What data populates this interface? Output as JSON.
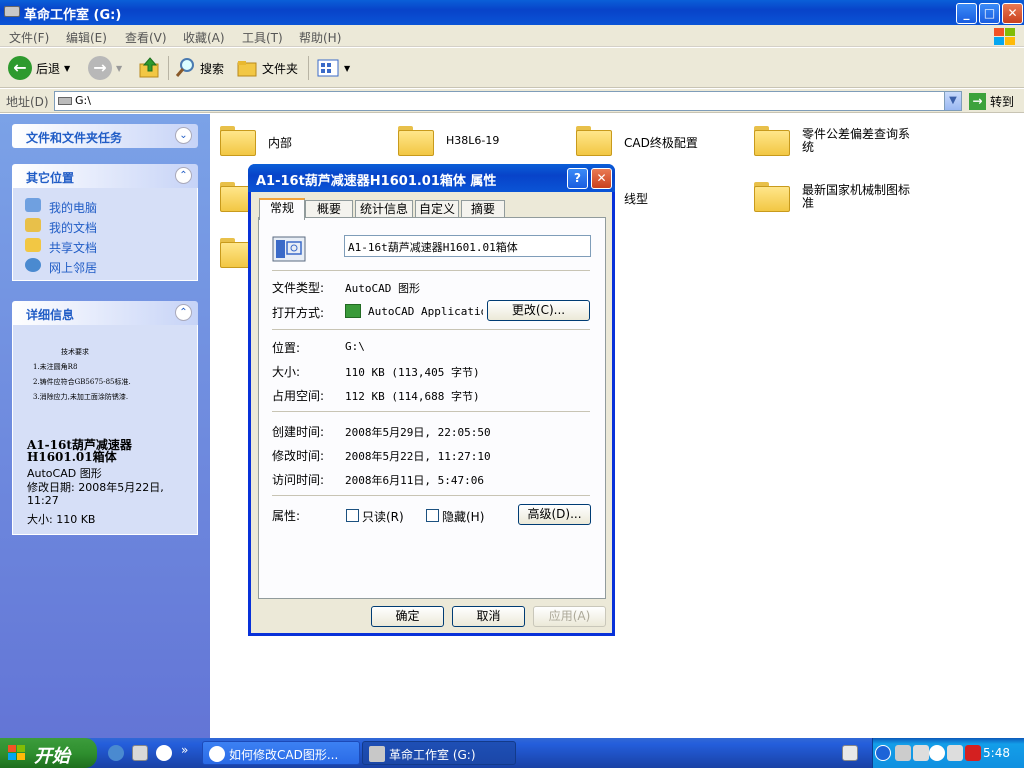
{
  "window": {
    "title": "革命工作室 (G:)",
    "controls": {
      "minimize": "_",
      "maximize": "□",
      "close": "✕"
    }
  },
  "menu": [
    "文件(F)",
    "编辑(E)",
    "查看(V)",
    "收藏(A)",
    "工具(T)",
    "帮助(H)"
  ],
  "toolbar": {
    "back_label": "后退",
    "search_label": "搜索",
    "folders_label": "文件夹"
  },
  "address": {
    "label": "地址(D)",
    "value": "G:\\",
    "go_label": "转到"
  },
  "left_pane": {
    "tasks_title": "文件和文件夹任务",
    "other_places_title": "其它位置",
    "other_places": [
      {
        "label": "我的电脑",
        "icon": "computer-icon"
      },
      {
        "label": "我的文档",
        "icon": "documents-icon"
      },
      {
        "label": "共享文档",
        "icon": "folder-icon"
      },
      {
        "label": "网上邻居",
        "icon": "network-icon"
      }
    ],
    "details_title": "详细信息",
    "thumb_lines": [
      "技术要求",
      "1.未注圆角R8",
      "2.铸件应符合GB5675-85标准.",
      "3.消除应力,未加工面涂防锈漆."
    ],
    "file_name": "A1-16t葫芦减速器H1601.01箱体",
    "file_type": "AutoCAD 图形",
    "modified": "修改日期: 2008年5月22日, 11:27",
    "size": "大小: 110 KB"
  },
  "files": [
    {
      "name": "内部"
    },
    {
      "name": "H38L6-19"
    },
    {
      "name": "CAD终极配置"
    },
    {
      "name": "零件公差偏差查询系统"
    },
    {
      "name": "线型"
    },
    {
      "name": "最新国家机械制图标准"
    }
  ],
  "dialog": {
    "title": "A1-16t葫芦减速器H1601.01箱体 属性",
    "help": "?",
    "close": "✕",
    "tabs": [
      "常规",
      "概要",
      "统计信息",
      "自定义",
      "摘要"
    ],
    "filename": "A1-16t葫芦减速器H1601.01箱体",
    "file_type_label": "文件类型:",
    "file_type": "AutoCAD 图形",
    "open_with_label": "打开方式:",
    "open_with": "AutoCAD Application",
    "change_btn": "更改(C)...",
    "location_label": "位置:",
    "location": "G:\\",
    "size_label": "大小:",
    "size": "110 KB (113,405 字节)",
    "size_on_disk_label": "占用空间:",
    "size_on_disk": "112 KB (114,688 字节)",
    "created_label": "创建时间:",
    "created": "2008年5月29日, 22:05:50",
    "modified_label": "修改时间:",
    "modified": "2008年5月22日, 11:27:10",
    "accessed_label": "访问时间:",
    "accessed": "2008年6月11日, 5:47:06",
    "attributes_label": "属性:",
    "readonly_label": "只读(R)",
    "hidden_label": "隐藏(H)",
    "advanced_btn": "高级(D)...",
    "ok_btn": "确定",
    "cancel_btn": "取消",
    "apply_btn": "应用(A)"
  },
  "taskbar": {
    "start": "开始",
    "more": "»",
    "tasks": [
      "如何修改CAD图形...",
      "革命工作室 (G:)"
    ],
    "clock": "5:48"
  }
}
